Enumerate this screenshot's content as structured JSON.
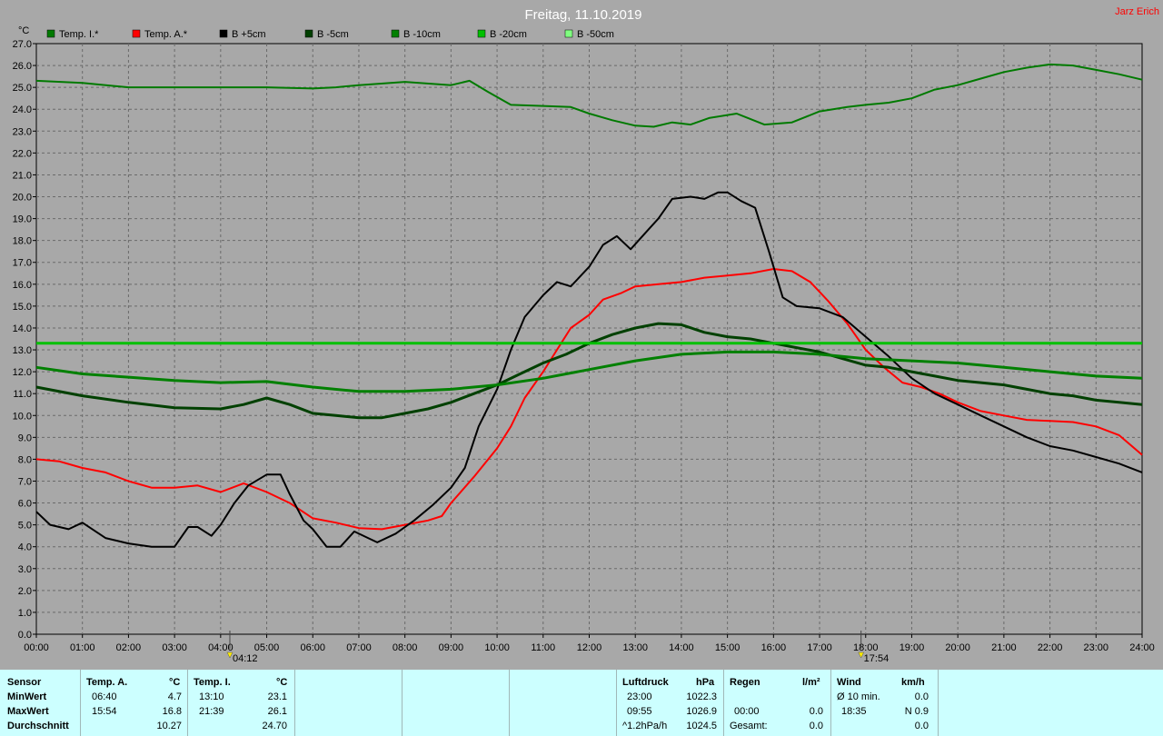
{
  "header": {
    "title": "Freitag, 11.10.2019",
    "author": "Jarz Erich",
    "unit": "°C"
  },
  "chart_data": {
    "type": "line",
    "title": "Freitag, 11.10.2019",
    "ylabel": "°C",
    "xlabel": "",
    "ylim": [
      0,
      27
    ],
    "xlim": [
      0,
      24
    ],
    "grid": true,
    "legend_position": "top-left",
    "y_ticks": [
      "0.0",
      "1.0",
      "2.0",
      "3.0",
      "4.0",
      "5.0",
      "6.0",
      "7.0",
      "8.0",
      "9.0",
      "10.0",
      "11.0",
      "12.0",
      "13.0",
      "14.0",
      "15.0",
      "16.0",
      "17.0",
      "18.0",
      "19.0",
      "20.0",
      "21.0",
      "22.0",
      "23.0",
      "24.0",
      "25.0",
      "26.0",
      "27.0"
    ],
    "x_ticks": [
      "00:00",
      "01:00",
      "02:00",
      "03:00",
      "04:00",
      "05:00",
      "06:00",
      "07:00",
      "08:00",
      "09:00",
      "10:00",
      "11:00",
      "12:00",
      "13:00",
      "14:00",
      "15:00",
      "16:00",
      "17:00",
      "18:00",
      "19:00",
      "20:00",
      "21:00",
      "22:00",
      "23:00",
      "24:00"
    ],
    "markers": [
      {
        "name": "sunrise",
        "time": 4.2,
        "label": "04:12"
      },
      {
        "name": "sunset",
        "time": 17.9,
        "label": "17:54"
      }
    ],
    "series": [
      {
        "name": "Temp. I.*",
        "color": "#007a00",
        "width": 2,
        "points": [
          [
            0,
            25.3
          ],
          [
            1,
            25.2
          ],
          [
            2,
            25.0
          ],
          [
            3,
            25.0
          ],
          [
            4,
            25.0
          ],
          [
            5,
            25.0
          ],
          [
            6,
            24.95
          ],
          [
            6.5,
            25.0
          ],
          [
            7,
            25.1
          ],
          [
            8,
            25.25
          ],
          [
            9,
            25.1
          ],
          [
            9.4,
            25.3
          ],
          [
            9.8,
            24.8
          ],
          [
            10.3,
            24.2
          ],
          [
            11,
            24.15
          ],
          [
            11.6,
            24.1
          ],
          [
            12,
            23.8
          ],
          [
            12.5,
            23.5
          ],
          [
            13,
            23.25
          ],
          [
            13.4,
            23.2
          ],
          [
            13.8,
            23.4
          ],
          [
            14.2,
            23.3
          ],
          [
            14.6,
            23.6
          ],
          [
            15.2,
            23.8
          ],
          [
            15.8,
            23.3
          ],
          [
            16.4,
            23.4
          ],
          [
            17,
            23.9
          ],
          [
            17.6,
            24.1
          ],
          [
            18,
            24.2
          ],
          [
            18.5,
            24.3
          ],
          [
            19,
            24.5
          ],
          [
            19.5,
            24.9
          ],
          [
            20,
            25.1
          ],
          [
            20.5,
            25.4
          ],
          [
            21,
            25.7
          ],
          [
            21.5,
            25.9
          ],
          [
            22,
            26.05
          ],
          [
            22.5,
            26.0
          ],
          [
            23,
            25.8
          ],
          [
            23.5,
            25.6
          ],
          [
            24,
            25.35
          ]
        ]
      },
      {
        "name": "Temp. A.*",
        "color": "#ff0000",
        "width": 2,
        "points": [
          [
            0,
            8.0
          ],
          [
            0.5,
            7.9
          ],
          [
            1,
            7.6
          ],
          [
            1.5,
            7.4
          ],
          [
            2,
            7.0
          ],
          [
            2.5,
            6.7
          ],
          [
            3,
            6.7
          ],
          [
            3.5,
            6.8
          ],
          [
            4,
            6.5
          ],
          [
            4.5,
            6.9
          ],
          [
            5,
            6.5
          ],
          [
            5.5,
            6.0
          ],
          [
            6,
            5.3
          ],
          [
            6.5,
            5.1
          ],
          [
            7,
            4.85
          ],
          [
            7.5,
            4.8
          ],
          [
            8,
            5.0
          ],
          [
            8.5,
            5.2
          ],
          [
            8.8,
            5.4
          ],
          [
            9,
            6.0
          ],
          [
            9.5,
            7.2
          ],
          [
            10,
            8.5
          ],
          [
            10.3,
            9.5
          ],
          [
            10.6,
            10.8
          ],
          [
            11,
            12.0
          ],
          [
            11.3,
            13.0
          ],
          [
            11.6,
            14.0
          ],
          [
            12,
            14.6
          ],
          [
            12.3,
            15.3
          ],
          [
            12.7,
            15.6
          ],
          [
            13,
            15.9
          ],
          [
            13.5,
            16.0
          ],
          [
            14,
            16.1
          ],
          [
            14.5,
            16.3
          ],
          [
            15,
            16.4
          ],
          [
            15.5,
            16.5
          ],
          [
            16,
            16.7
          ],
          [
            16.4,
            16.6
          ],
          [
            16.8,
            16.1
          ],
          [
            17.2,
            15.2
          ],
          [
            17.6,
            14.2
          ],
          [
            18,
            13.0
          ],
          [
            18.4,
            12.2
          ],
          [
            18.8,
            11.5
          ],
          [
            19.2,
            11.3
          ],
          [
            19.6,
            11.0
          ],
          [
            20,
            10.6
          ],
          [
            20.5,
            10.2
          ],
          [
            21,
            10.0
          ],
          [
            21.5,
            9.8
          ],
          [
            22,
            9.75
          ],
          [
            22.5,
            9.7
          ],
          [
            23,
            9.5
          ],
          [
            23.5,
            9.1
          ],
          [
            24,
            8.2
          ]
        ]
      },
      {
        "name": "B +5cm",
        "color": "#000000",
        "width": 2,
        "points": [
          [
            0,
            5.6
          ],
          [
            0.3,
            5.0
          ],
          [
            0.7,
            4.8
          ],
          [
            1,
            5.1
          ],
          [
            1.5,
            4.4
          ],
          [
            2,
            4.15
          ],
          [
            2.5,
            4.0
          ],
          [
            3,
            4.0
          ],
          [
            3.3,
            4.9
          ],
          [
            3.5,
            4.9
          ],
          [
            3.8,
            4.5
          ],
          [
            4,
            5.0
          ],
          [
            4.3,
            6.0
          ],
          [
            4.6,
            6.8
          ],
          [
            5,
            7.3
          ],
          [
            5.3,
            7.3
          ],
          [
            5.5,
            6.4
          ],
          [
            5.8,
            5.2
          ],
          [
            6,
            4.8
          ],
          [
            6.3,
            4.0
          ],
          [
            6.6,
            4.0
          ],
          [
            6.9,
            4.7
          ],
          [
            7.2,
            4.4
          ],
          [
            7.4,
            4.2
          ],
          [
            7.8,
            4.6
          ],
          [
            8.2,
            5.2
          ],
          [
            8.6,
            5.9
          ],
          [
            9,
            6.7
          ],
          [
            9.3,
            7.6
          ],
          [
            9.6,
            9.5
          ],
          [
            10,
            11.2
          ],
          [
            10.3,
            13.0
          ],
          [
            10.6,
            14.5
          ],
          [
            11,
            15.5
          ],
          [
            11.3,
            16.1
          ],
          [
            11.6,
            15.9
          ],
          [
            12,
            16.8
          ],
          [
            12.3,
            17.8
          ],
          [
            12.6,
            18.2
          ],
          [
            12.9,
            17.6
          ],
          [
            13.2,
            18.3
          ],
          [
            13.5,
            19.0
          ],
          [
            13.8,
            19.9
          ],
          [
            14.2,
            20.0
          ],
          [
            14.5,
            19.9
          ],
          [
            14.8,
            20.2
          ],
          [
            15,
            20.2
          ],
          [
            15.3,
            19.8
          ],
          [
            15.6,
            19.5
          ],
          [
            15.9,
            17.5
          ],
          [
            16.2,
            15.4
          ],
          [
            16.5,
            15.0
          ],
          [
            17,
            14.9
          ],
          [
            17.5,
            14.5
          ],
          [
            18,
            13.6
          ],
          [
            18.5,
            12.7
          ],
          [
            19,
            11.7
          ],
          [
            19.5,
            11.0
          ],
          [
            20,
            10.5
          ],
          [
            20.5,
            10.0
          ],
          [
            21,
            9.5
          ],
          [
            21.5,
            9.0
          ],
          [
            22,
            8.6
          ],
          [
            22.5,
            8.4
          ],
          [
            23,
            8.1
          ],
          [
            23.5,
            7.8
          ],
          [
            24,
            7.4
          ]
        ]
      },
      {
        "name": "B -5cm",
        "color": "#004000",
        "width": 3,
        "points": [
          [
            0,
            11.3
          ],
          [
            1,
            10.9
          ],
          [
            2,
            10.6
          ],
          [
            3,
            10.35
          ],
          [
            4,
            10.3
          ],
          [
            4.5,
            10.5
          ],
          [
            5,
            10.8
          ],
          [
            5.5,
            10.5
          ],
          [
            6,
            10.1
          ],
          [
            6.5,
            10.0
          ],
          [
            7,
            9.9
          ],
          [
            7.5,
            9.9
          ],
          [
            8,
            10.1
          ],
          [
            8.5,
            10.3
          ],
          [
            9,
            10.6
          ],
          [
            9.5,
            11.0
          ],
          [
            10,
            11.4
          ],
          [
            10.5,
            11.9
          ],
          [
            11,
            12.4
          ],
          [
            11.5,
            12.8
          ],
          [
            12,
            13.3
          ],
          [
            12.5,
            13.7
          ],
          [
            13,
            14.0
          ],
          [
            13.5,
            14.2
          ],
          [
            14,
            14.15
          ],
          [
            14.5,
            13.8
          ],
          [
            15,
            13.6
          ],
          [
            15.5,
            13.5
          ],
          [
            16,
            13.3
          ],
          [
            16.5,
            13.1
          ],
          [
            17,
            12.9
          ],
          [
            17.5,
            12.6
          ],
          [
            18,
            12.3
          ],
          [
            18.5,
            12.2
          ],
          [
            19,
            12.0
          ],
          [
            19.5,
            11.8
          ],
          [
            20,
            11.6
          ],
          [
            20.5,
            11.5
          ],
          [
            21,
            11.4
          ],
          [
            21.5,
            11.2
          ],
          [
            22,
            11.0
          ],
          [
            22.5,
            10.9
          ],
          [
            23,
            10.7
          ],
          [
            23.5,
            10.6
          ],
          [
            24,
            10.5
          ]
        ]
      },
      {
        "name": "B -10cm",
        "color": "#008000",
        "width": 3,
        "points": [
          [
            0,
            12.2
          ],
          [
            1,
            11.9
          ],
          [
            2,
            11.75
          ],
          [
            3,
            11.6
          ],
          [
            4,
            11.5
          ],
          [
            5,
            11.55
          ],
          [
            6,
            11.3
          ],
          [
            7,
            11.1
          ],
          [
            8,
            11.1
          ],
          [
            9,
            11.2
          ],
          [
            10,
            11.4
          ],
          [
            11,
            11.7
          ],
          [
            12,
            12.1
          ],
          [
            13,
            12.5
          ],
          [
            14,
            12.8
          ],
          [
            15,
            12.9
          ],
          [
            16,
            12.9
          ],
          [
            17,
            12.8
          ],
          [
            18,
            12.6
          ],
          [
            19,
            12.5
          ],
          [
            20,
            12.4
          ],
          [
            21,
            12.2
          ],
          [
            22,
            12.0
          ],
          [
            23,
            11.8
          ],
          [
            24,
            11.7
          ]
        ]
      },
      {
        "name": "B -20cm",
        "color": "#00c000",
        "width": 3,
        "points": [
          [
            0,
            13.3
          ],
          [
            24,
            13.3
          ]
        ]
      },
      {
        "name": "B -50cm",
        "color": "#80ff80",
        "width": 2,
        "points": []
      }
    ]
  },
  "stats": {
    "sensor": "Sensor",
    "rows": {
      "min": "MinWert",
      "max": "MaxWert",
      "avg": "Durchschnitt"
    },
    "temp_a": {
      "label": "Temp. A.",
      "unit": "°C",
      "min_time": "06:40",
      "min_val": "4.7",
      "max_time": "15:54",
      "max_val": "16.8",
      "avg": "10.27"
    },
    "temp_i": {
      "label": "Temp. I.",
      "unit": "°C",
      "min_time": "13:10",
      "min_val": "23.1",
      "max_time": "21:39",
      "max_val": "26.1",
      "avg": "24.70"
    },
    "pressure": {
      "label": "Luftdruck",
      "unit": "hPa",
      "r1_time": "23:00",
      "r1_val": "1022.3",
      "r2_time": "09:55",
      "r2_val": "1026.9",
      "r3_time": "^1.2hPa/h",
      "r3_val": "1024.5"
    },
    "rain": {
      "label": "Regen",
      "unit": "l/m²",
      "r1_time": "",
      "r1_val": "",
      "r2_time": "00:00",
      "r2_val": "0.0",
      "r3_time": "Gesamt:",
      "r3_val": "0.0"
    },
    "wind": {
      "label": "Wind",
      "unit": "km/h",
      "r1_time": "Ø 10 min.",
      "r1_val": "0.0",
      "r2_time": "18:35",
      "r2_val": "N 0.9",
      "r3_time": "",
      "r3_val": "0.0"
    }
  }
}
